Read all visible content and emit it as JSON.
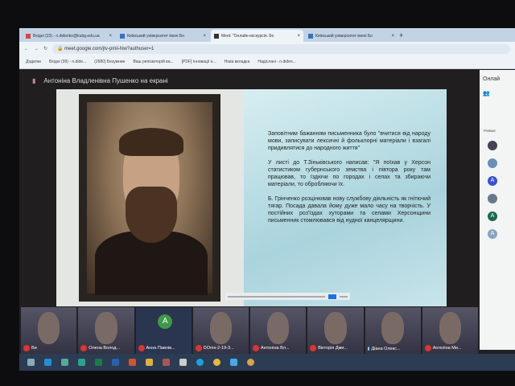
{
  "browser": {
    "tabs": [
      {
        "label": "Вхідні (23) - n.didenko@kubg.edu.ua",
        "active": false
      },
      {
        "label": "Київський університет імені Бо",
        "active": false
      },
      {
        "label": "Meet: \"Онлайн-екскурсія. Бо",
        "active": true
      },
      {
        "label": "Київський університет імені Бо",
        "active": false
      }
    ],
    "new_tab": "+",
    "url": "meet.google.com/jtv-pmii-hiw?authuser=1",
    "bookmarks": [
      "Додатки",
      "Вхідні (99) - n.dide...",
      "(2680) Безумние",
      "Ваш репозиторій ва...",
      "[PDF] Інновації н...",
      "Нова вкладка",
      "Надіслані - n.diden..."
    ]
  },
  "meet": {
    "presenter": "Антоніна Владленівна Пушенко на екрані",
    "slide_paragraphs": [
      "Заповітним бажанням письменника було \"вчитися від народу мови, записувати лексичні й фольклорні матеріали і взагалі придивлятися до народного життя\"",
      "У листі до Т.Зіньківського написав: \"Я поїхав у Херсон статистиком губернського земства і півтора року там працював, то їздючи по городах і селах та збираючи матеріали, то обробляючи їх.",
      "Б. Грінченко розцінював нову службову діяльність як гнітючий тягар. Посада давала йому дуже мало часу на творчість. У постійних роз'їздах хуторами та селами Херсонщини письменник стомлювався від нудної канцелярщини."
    ],
    "side_title": "Онлай",
    "side_section": "ТРИВАЄ",
    "participants": [
      {
        "name": "Ви",
        "muted": true
      },
      {
        "name": "Олена Волод...",
        "muted": true
      },
      {
        "name": "Анна Павлів...",
        "muted": true,
        "initial": "A"
      },
      {
        "name": "DOms-2-19-3...",
        "muted": true
      },
      {
        "name": "Антоніна Вл...",
        "muted": true
      },
      {
        "name": "Вікторія Дми...",
        "muted": true
      },
      {
        "name": "Діана Олекс...",
        "muted": false
      },
      {
        "name": "Ангеліна Ми...",
        "muted": true
      }
    ]
  },
  "colors": {
    "accent": "#1a73e8",
    "muted": "#d33333"
  }
}
